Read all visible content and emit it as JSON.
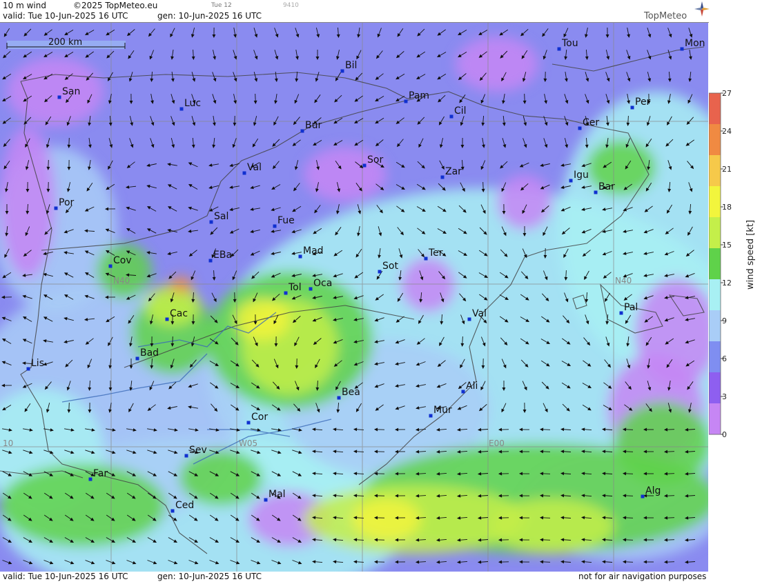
{
  "header": {
    "product": "10 m wind",
    "copyright": "©2025 TopMeteo.eu",
    "tab_time": "Tue 12",
    "tab_code": "9410",
    "valid": "valid:  Tue  10-Jun-2025  16 UTC",
    "gen": "gen: 10-Jun-2025 16 UTC",
    "brand": "TopMeteo"
  },
  "footer": {
    "valid": "valid:  Tue  10-Jun-2025  16 UTC",
    "gen": "gen: 10-Jun-2025 16 UTC",
    "notice": "not for air navigation purposes"
  },
  "scale": {
    "label": "200 km"
  },
  "grid_labels": {
    "lat": "N40",
    "lon_w05": "W05",
    "lon_e00": "E00",
    "lon_w10": "10"
  },
  "legend": {
    "title": "wind speed  [kt]",
    "ticks": [
      "27",
      "24",
      "21",
      "18",
      "15",
      "12",
      "9",
      "6",
      "3",
      "0"
    ],
    "colors": [
      "#e8634d",
      "#f08a42",
      "#f6c94a",
      "#f2f53d",
      "#c4ef4a",
      "#5fd24a",
      "#a8f0f3",
      "#a9cdf7",
      "#7f8ef1",
      "#8e5ff0",
      "#c686f4"
    ]
  },
  "cities": [
    {
      "name": "San"
    },
    {
      "name": "Luc"
    },
    {
      "name": "Bil"
    },
    {
      "name": "Pam"
    },
    {
      "name": "Cil"
    },
    {
      "name": "Tou"
    },
    {
      "name": "Mon"
    },
    {
      "name": "Per"
    },
    {
      "name": "Cer"
    },
    {
      "name": "Bur"
    },
    {
      "name": "Sor"
    },
    {
      "name": "Zar"
    },
    {
      "name": "Igu"
    },
    {
      "name": "Bar"
    },
    {
      "name": "Val"
    },
    {
      "name": "Por"
    },
    {
      "name": "Sal"
    },
    {
      "name": "Fue"
    },
    {
      "name": "Cov"
    },
    {
      "name": "EBa"
    },
    {
      "name": "Mad"
    },
    {
      "name": "Sot"
    },
    {
      "name": "Ter"
    },
    {
      "name": "Tol"
    },
    {
      "name": "Oca"
    },
    {
      "name": "Cac"
    },
    {
      "name": "Val"
    },
    {
      "name": "Pal"
    },
    {
      "name": "Bad"
    },
    {
      "name": "Lis"
    },
    {
      "name": "Bea"
    },
    {
      "name": "Ali"
    },
    {
      "name": "Mur"
    },
    {
      "name": "Cor"
    },
    {
      "name": "Sev"
    },
    {
      "name": "Far"
    },
    {
      "name": "Mal"
    },
    {
      "name": "Ced"
    },
    {
      "name": "Alg"
    }
  ]
}
